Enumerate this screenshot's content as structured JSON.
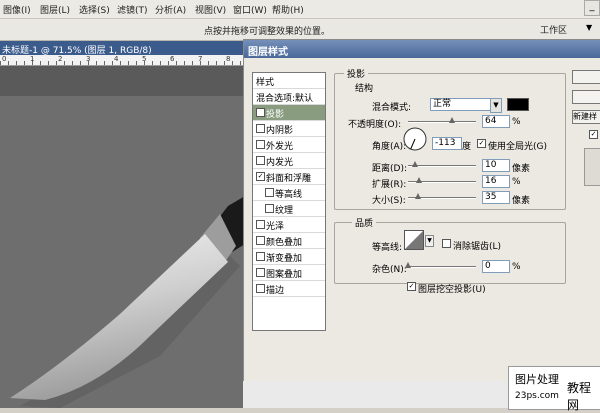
{
  "menubar": {
    "items": [
      "图像(I)",
      "图层(L)",
      "选择(S)",
      "滤镜(T)",
      "分析(A)",
      "视图(V)",
      "窗口(W)",
      "帮助(H)"
    ],
    "min_label": "_"
  },
  "optionsbar": {
    "hint": "点按并拖移可调整效果的位置。",
    "workspace": "工作区",
    "workspace_arrow": "▼"
  },
  "document": {
    "title": "未标题-1 @ 71.5% (图层 1, RGB/8)",
    "ruler_numbers": [
      "0",
      "1",
      "2",
      "3",
      "4",
      "5",
      "6",
      "7",
      "8"
    ]
  },
  "dialog": {
    "title": "图层样式",
    "style_list": {
      "header": "样式",
      "blend": "混合选项:默认",
      "items": [
        {
          "label": "投影",
          "checked": true,
          "selected": true
        },
        {
          "label": "内阴影",
          "checked": false
        },
        {
          "label": "外发光",
          "checked": false
        },
        {
          "label": "内发光",
          "checked": false
        },
        {
          "label": "斜面和浮雕",
          "checked": true
        },
        {
          "label": "等高线",
          "checked": false,
          "sub": true
        },
        {
          "label": "纹理",
          "checked": false,
          "sub": true
        },
        {
          "label": "光泽",
          "checked": false
        },
        {
          "label": "颜色叠加",
          "checked": false
        },
        {
          "label": "渐变叠加",
          "checked": false
        },
        {
          "label": "图案叠加",
          "checked": false
        },
        {
          "label": "描边",
          "checked": false
        }
      ]
    },
    "drop_shadow": {
      "section_title": "投影",
      "structure_title": "结构",
      "blend_mode_label": "混合模式:",
      "blend_mode_value": "正常",
      "shadow_color": "#000000",
      "opacity_label": "不透明度(O):",
      "opacity_value": "64",
      "opacity_unit": "%",
      "opacity_level": 64,
      "angle_label": "角度(A):",
      "angle_value": "-113",
      "angle_unit": "度",
      "global_light_label": "使用全局光(G)",
      "global_light_checked": true,
      "distance_label": "距离(D):",
      "distance_value": "10",
      "distance_unit": "像素",
      "distance_level": 0.1,
      "spread_label": "扩展(R):",
      "spread_value": "16",
      "spread_unit": "%",
      "spread_level": 0.16,
      "size_label": "大小(S):",
      "size_value": "35",
      "size_unit": "像素",
      "size_level": 0.14
    },
    "quality": {
      "title": "品质",
      "contour_label": "等高线:",
      "antialias_label": "消除锯齿(L)",
      "antialias_checked": false,
      "noise_label": "杂色(N):",
      "noise_value": "0",
      "noise_unit": "%",
      "knockout_label": "图层挖空投影(U)",
      "knockout_checked": true
    },
    "buttons": {
      "new_style": "新建样"
    }
  },
  "watermark": {
    "line1": "图片处理",
    "line2": "教程网",
    "line3": "23ps.com"
  }
}
